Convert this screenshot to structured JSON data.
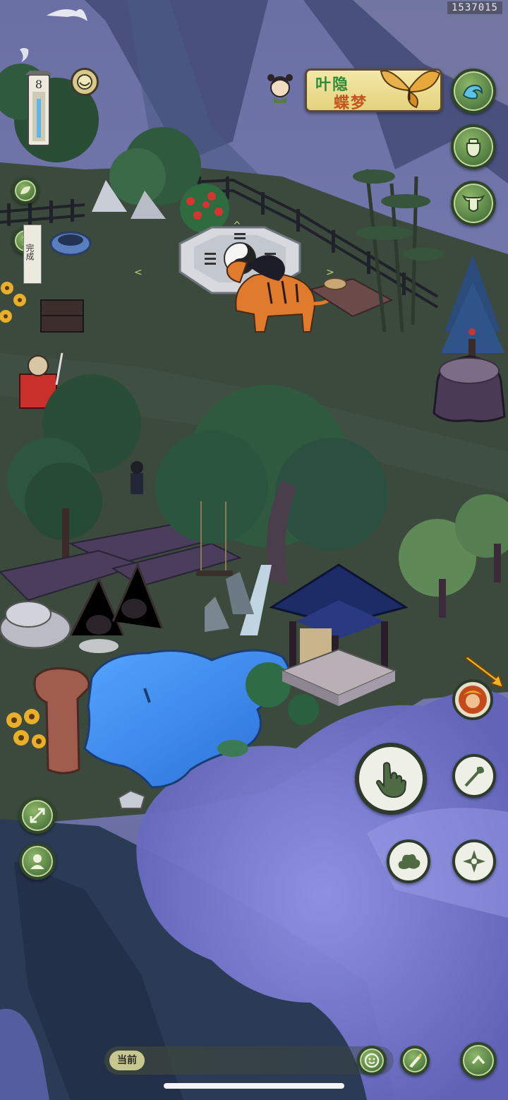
{
  "build_id": "1537015",
  "stage_counter": "8",
  "event_banner": {
    "line1": "叶隐",
    "line2": "蝶梦"
  },
  "task_card": {
    "text": "完成"
  },
  "chat": {
    "channel_label": "当前"
  },
  "right_menu": [
    {
      "name": "wave-icon"
    },
    {
      "name": "pouch-icon"
    },
    {
      "name": "ox-head-icon"
    }
  ],
  "action_buttons": [
    {
      "name": "interact-hand-icon"
    },
    {
      "name": "spear-icon"
    },
    {
      "name": "cloud-icon"
    },
    {
      "name": "shuriken-icon"
    }
  ],
  "bottom_buttons": [
    {
      "name": "emote-icon"
    },
    {
      "name": "brush-icon"
    },
    {
      "name": "expand-up-icon"
    }
  ],
  "colors": {
    "hud_green": "#6f9a55",
    "hud_border": "#2f4629",
    "banner_gold": "#efe29a",
    "water": "#2f7fe0",
    "grass": "#3c4a3f",
    "mist": "#6d6fc2"
  }
}
